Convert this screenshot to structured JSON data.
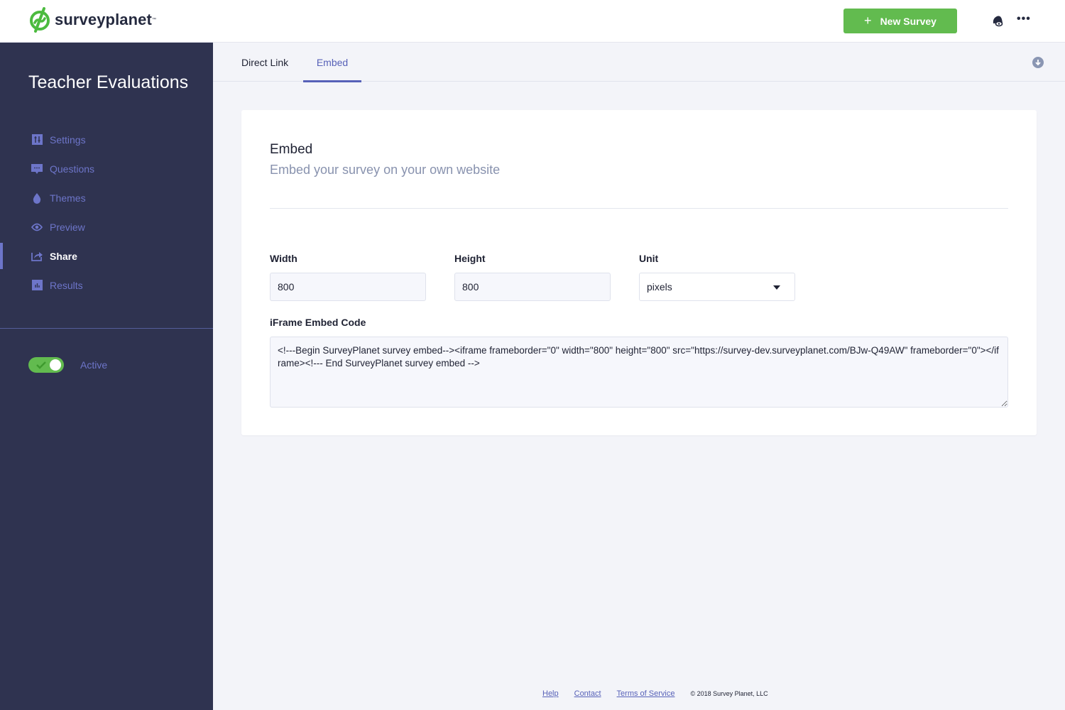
{
  "header": {
    "brand": "surveyplanet",
    "brand_tm": "™",
    "new_survey_label": "New Survey",
    "new_survey_icon": "plus-icon",
    "notifications_icon": "bell-icon",
    "more_icon": "more-horizontal-icon",
    "more_glyph": "•••",
    "accent_color": "#62bb4f"
  },
  "sidebar": {
    "survey_title": "Teacher Evaluations",
    "items": [
      {
        "label": "Settings",
        "icon": "sliders-icon",
        "active": false
      },
      {
        "label": "Questions",
        "icon": "comment-icon",
        "active": false
      },
      {
        "label": "Themes",
        "icon": "droplet-icon",
        "active": false
      },
      {
        "label": "Preview",
        "icon": "eye-icon",
        "active": false
      },
      {
        "label": "Share",
        "icon": "share-icon",
        "active": true
      },
      {
        "label": "Results",
        "icon": "bar-chart-icon",
        "active": false
      }
    ],
    "status_toggle": {
      "label": "Active",
      "on": true
    },
    "background_color": "#2f3350",
    "link_color": "#6d75c9"
  },
  "tabs": {
    "items": [
      {
        "label": "Direct Link",
        "active": false
      },
      {
        "label": "Embed",
        "active": true
      }
    ],
    "download_icon": "download-icon"
  },
  "embed_card": {
    "title": "Embed",
    "subtitle": "Embed your survey on your own website",
    "width_label": "Width",
    "width_value": "800",
    "height_label": "Height",
    "height_value": "800",
    "unit_label": "Unit",
    "unit_value": "pixels",
    "code_label": "iFrame Embed Code",
    "code_value": "<!---Begin SurveyPlanet survey embed--><iframe frameborder=\"0\" width=\"800\" height=\"800\" src=\"https://survey-dev.surveyplanet.com/BJw-Q49AW\" frameborder=\"0\"></iframe><!--- End SurveyPlanet survey embed -->"
  },
  "footer": {
    "links": [
      "Help",
      "Contact",
      "Terms of Service"
    ],
    "copyright": "© 2018 Survey Planet, LLC"
  }
}
